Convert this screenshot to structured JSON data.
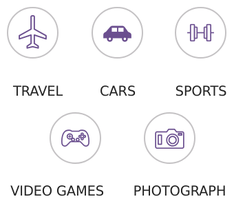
{
  "icon_color": "#6b4f8f",
  "border_color": "#c4c2c4",
  "categories": [
    {
      "label": "TRAVEL",
      "icon": "airplane-icon"
    },
    {
      "label": "CARS",
      "icon": "car-icon"
    },
    {
      "label": "SPORTS",
      "icon": "dumbbell-icon"
    },
    {
      "label": "VIDEO GAMES",
      "icon": "gamepad-icon"
    },
    {
      "label": "PHOTOGRAPH",
      "icon": "camera-icon"
    }
  ]
}
